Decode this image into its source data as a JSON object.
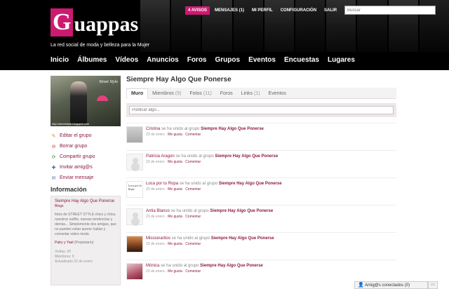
{
  "header": {
    "logo_initial": "G",
    "logo_rest": "uappas",
    "tagline": "La red social de moda y belleza para la Mujer",
    "top_links": [
      "4 AVISOS",
      "MENSAJES (1)",
      "MI PERFIL",
      "CONFIGURACIÓN",
      "SALIR"
    ],
    "search_placeholder": "Buscar",
    "nav": [
      "Inicio",
      "Álbumes",
      "Vídeos",
      "Anuncios",
      "Foros",
      "Grupos",
      "Eventos",
      "Encuestas",
      "Lugares"
    ]
  },
  "sidebar": {
    "image_tag": "Street Style",
    "image_caption": "http://streetstyle.blogspot.com",
    "actions": [
      {
        "label": "Editar el grupo",
        "icon": "pencil-icon"
      },
      {
        "label": "Borrar grupo",
        "icon": "delete-icon"
      },
      {
        "label": "Compartir grupo",
        "icon": "share-icon"
      },
      {
        "label": "Invitar amig@s",
        "icon": "invite-icon"
      },
      {
        "label": "Enviar mensaje",
        "icon": "mail-icon"
      }
    ],
    "info_title": "Información",
    "info": {
      "group_name": "Siempre Hay Algo Que Ponerse",
      "category": "Blogs",
      "description": "fotos de STREET STYLE chico y chica, nuestros outfits, nuevas tendencias y demás... Simplemente dos amigas, que no pueden evitar querer hablar y comentar sobre moda",
      "owner": "Patry y Yael",
      "owner_role": "(Propietario)",
      "visits": "Visitas: 20",
      "members": "Miembros: 9",
      "updated": "Actualizado 22 de enero"
    }
  },
  "main": {
    "title": "Siempre Hay Algo Que Ponerse",
    "tabs": [
      {
        "label": "Muro",
        "count": ""
      },
      {
        "label": "Miembros",
        "count": "(9)"
      },
      {
        "label": "Fotos",
        "count": "(11)"
      },
      {
        "label": "Foros",
        "count": ""
      },
      {
        "label": "Links",
        "count": "(1)"
      },
      {
        "label": "Eventos",
        "count": ""
      }
    ],
    "post_placeholder": "Publicar algo...",
    "feed": [
      {
        "user": "Cristina",
        "action": " se ha unido al grupo ",
        "group": "Siempre Hay Algo Que Ponerse",
        "date": "23 de enero",
        "like": "Me gusta",
        "comment": "Comentar"
      },
      {
        "user": "Patricia Aragon",
        "action": " se ha unido al grupo ",
        "group": "Siempre Hay Algo Que Ponerse",
        "date": "23 de enero",
        "like": "Me gusta",
        "comment": "Comentar"
      },
      {
        "user": "Loca por tu Ropa",
        "action": " se ha unido al grupo ",
        "group": "Siempre Hay Algo Que Ponerse",
        "date": "23 de enero",
        "like": "Me gusta",
        "comment": "Comentar"
      },
      {
        "user": "Antia Blanco",
        "action": " se ha unido al grupo ",
        "group": "Siempre Hay Algo Que Ponerse",
        "date": "23 de enero",
        "like": "Me gusta",
        "comment": "Comentar"
      },
      {
        "user": "Missiunaritos",
        "action": " se ha unido al grupo ",
        "group": "Siempre Hay Algo Que Ponerse",
        "date": "23 de enero",
        "like": "Me gusta",
        "comment": "Comentar"
      },
      {
        "user": "Mónica",
        "action": " se ha unido al grupo ",
        "group": "Siempre Hay Algo Que Ponerse",
        "date": "23 de enero",
        "like": "Me gusta",
        "comment": "Comentar"
      }
    ]
  },
  "chat": {
    "label": "Amig@s conectados (0)"
  },
  "colors": {
    "accent": "#cc1a70",
    "link": "#8b1a45",
    "header_bg": "#000000"
  }
}
